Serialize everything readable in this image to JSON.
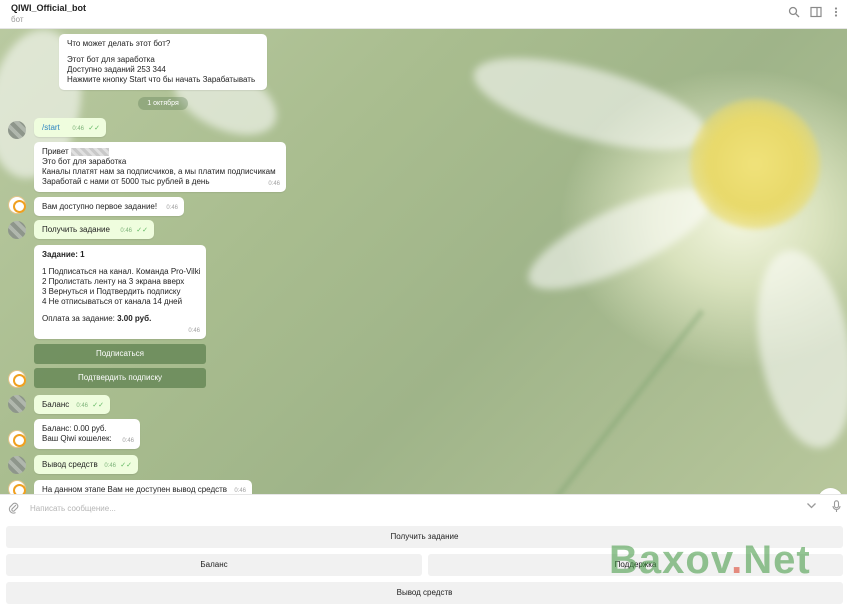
{
  "header": {
    "title": "QIWI_Official_bot",
    "subtitle": "бот"
  },
  "chat": {
    "intro": {
      "heading": "Что может делать этот бот?",
      "lines": [
        "Этот бот для заработка",
        "Доступно заданий 253 344",
        "Нажмите кнопку Start что бы начать Зарабатывать"
      ]
    },
    "date": "1 октября",
    "m_start": {
      "text": "/start",
      "time": "0:46"
    },
    "m_hello": {
      "lines": [
        "Привет",
        "Это бот для заработка",
        "Каналы платят нам за подписчиков, а мы платим подписчикам",
        "Заработай с нами от 5000 тыс рублей в день"
      ],
      "time": "0:46"
    },
    "m_first": {
      "text": "Вам доступно первое задание!",
      "time": "0:46"
    },
    "m_get": {
      "text": "Получить задание",
      "time": "0:46"
    },
    "m_task": {
      "title": "Задание: 1",
      "lines": [
        "1 Подписаться на канал. Команда Pro-Vilki",
        "2 Пролистать ленту на 3 экрана вверх",
        "3 Вернуться и Подтвердить подписку",
        "4 Не отписываться от канала 14 дней"
      ],
      "pay_label": "Оплата за задание:",
      "pay_value": "3.00 руб.",
      "time": "0:46"
    },
    "inline_buttons": {
      "subscribe": "Подписаться",
      "confirm": "Подтвердить подписку"
    },
    "m_balance_req": {
      "text": "Баланс",
      "time": "0:46"
    },
    "m_balance": {
      "lines": [
        "Баланс: 0.00 руб.",
        "Ваш Qiwi кошелек:"
      ],
      "time": "0:46"
    },
    "m_withdraw_req": {
      "text": "Вывод средств",
      "time": "0:46"
    },
    "m_withdraw": {
      "text": "На данном этапе Вам не доступен вывод средств",
      "time": "0:46"
    }
  },
  "input": {
    "placeholder": "Написать сообщение..."
  },
  "keyboard": {
    "get_task": "Получить задание",
    "balance": "Баланс",
    "support": "Поддержка",
    "withdraw": "Вывод средств"
  },
  "watermark": {
    "part1": "Baxov",
    "dot": ".",
    "part2": "Net"
  },
  "colors": {
    "outgoing_bubble": "#effdde",
    "incoming_bubble": "#ffffff",
    "inline_button": "#5f8250",
    "watermark_green": "#3c963c"
  }
}
